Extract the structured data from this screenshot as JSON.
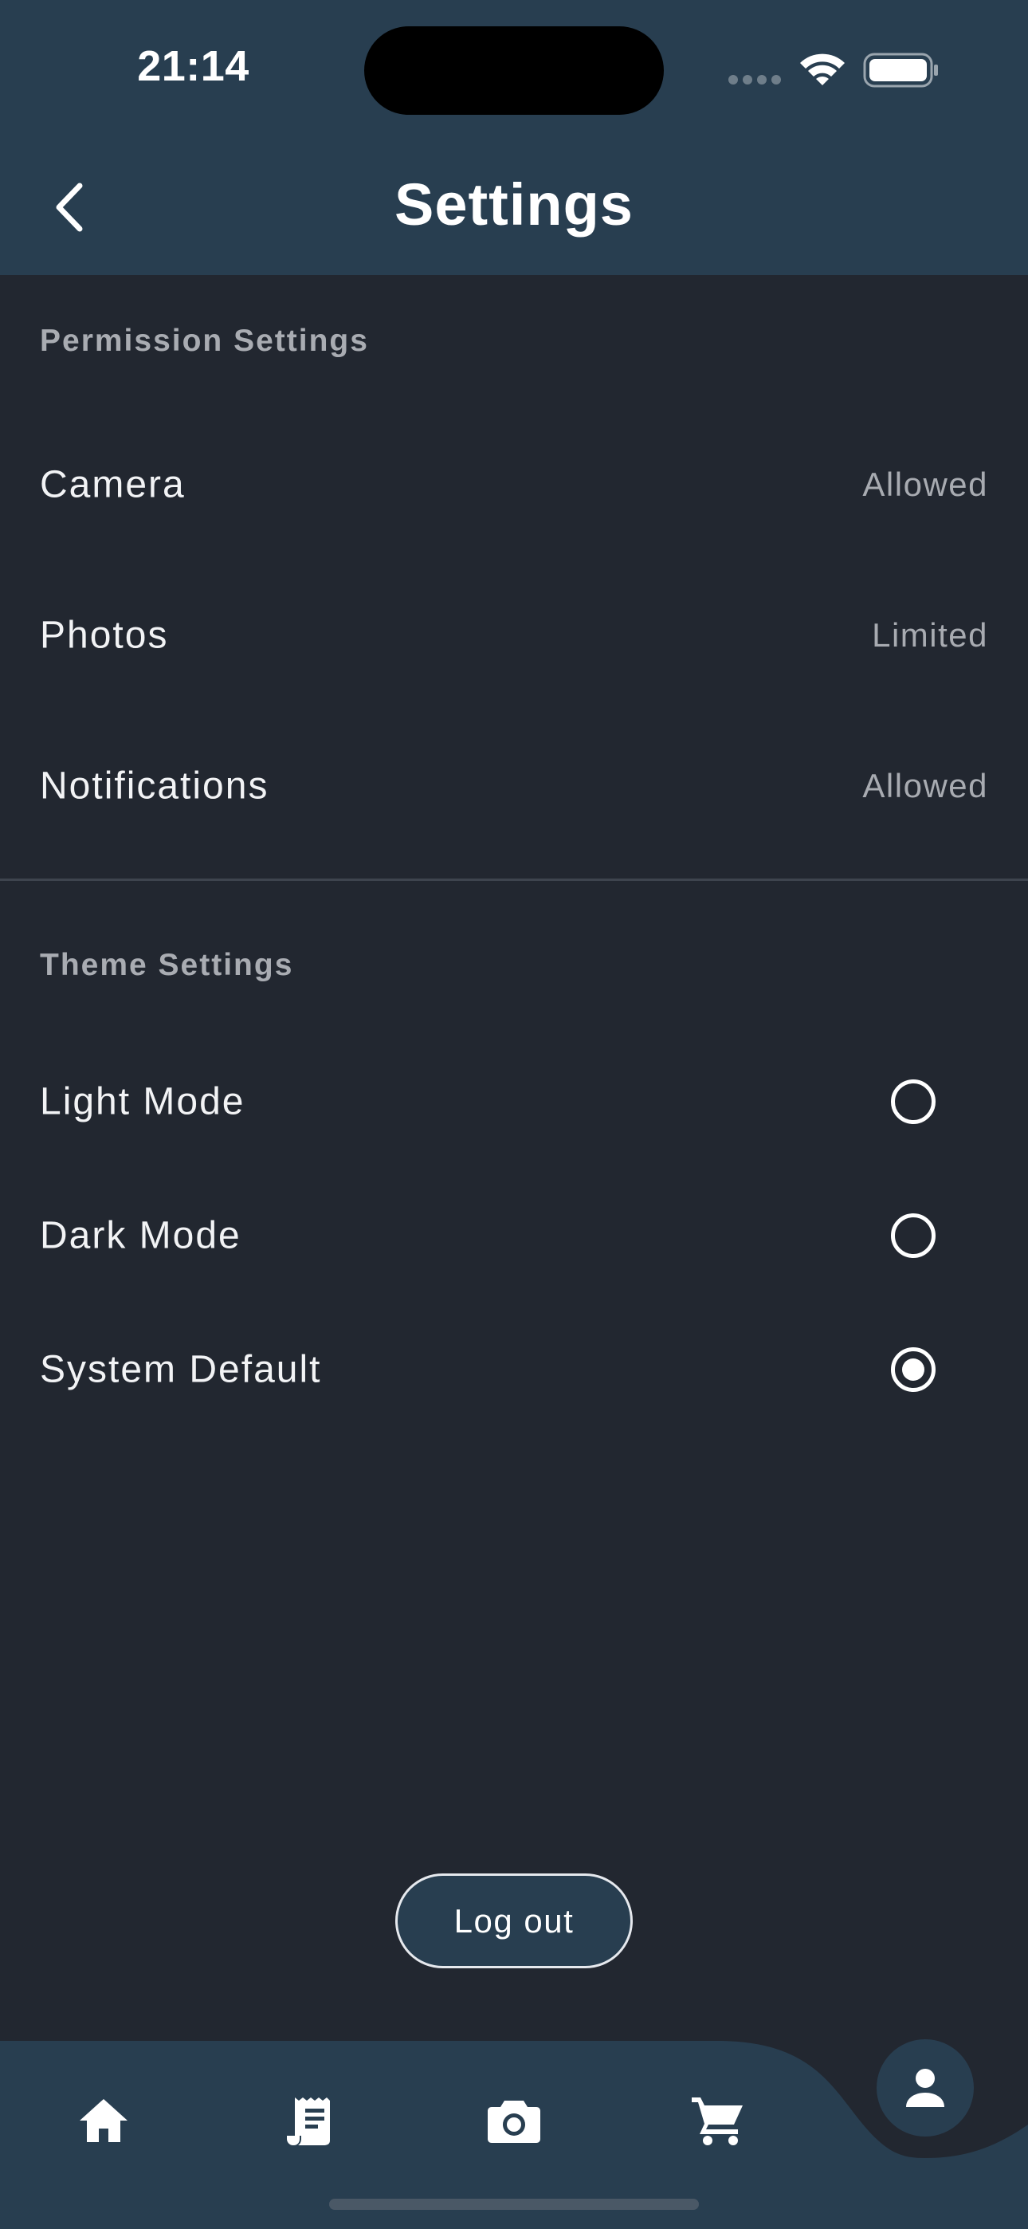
{
  "status_bar": {
    "time": "21:14"
  },
  "header": {
    "title": "Settings",
    "back_icon": "chevron-left-icon"
  },
  "permission_section": {
    "title": "Permission Settings",
    "items": [
      {
        "label": "Camera",
        "value": "Allowed"
      },
      {
        "label": "Photos",
        "value": "Limited"
      },
      {
        "label": "Notifications",
        "value": "Allowed"
      }
    ]
  },
  "theme_section": {
    "title": "Theme Settings",
    "options": [
      {
        "label": "Light Mode",
        "selected": false
      },
      {
        "label": "Dark Mode",
        "selected": false
      },
      {
        "label": "System Default",
        "selected": true
      }
    ]
  },
  "logout": {
    "label": "Log out"
  },
  "bottom_nav": {
    "items": [
      {
        "icon": "home-icon"
      },
      {
        "icon": "receipt-icon"
      },
      {
        "icon": "camera-icon"
      },
      {
        "icon": "cart-icon"
      },
      {
        "icon": "profile-icon",
        "active": true
      }
    ]
  },
  "colors": {
    "background": "#222730",
    "header": "#283e50",
    "secondary_text": "#a8abb1",
    "divider": "#3e444e"
  }
}
